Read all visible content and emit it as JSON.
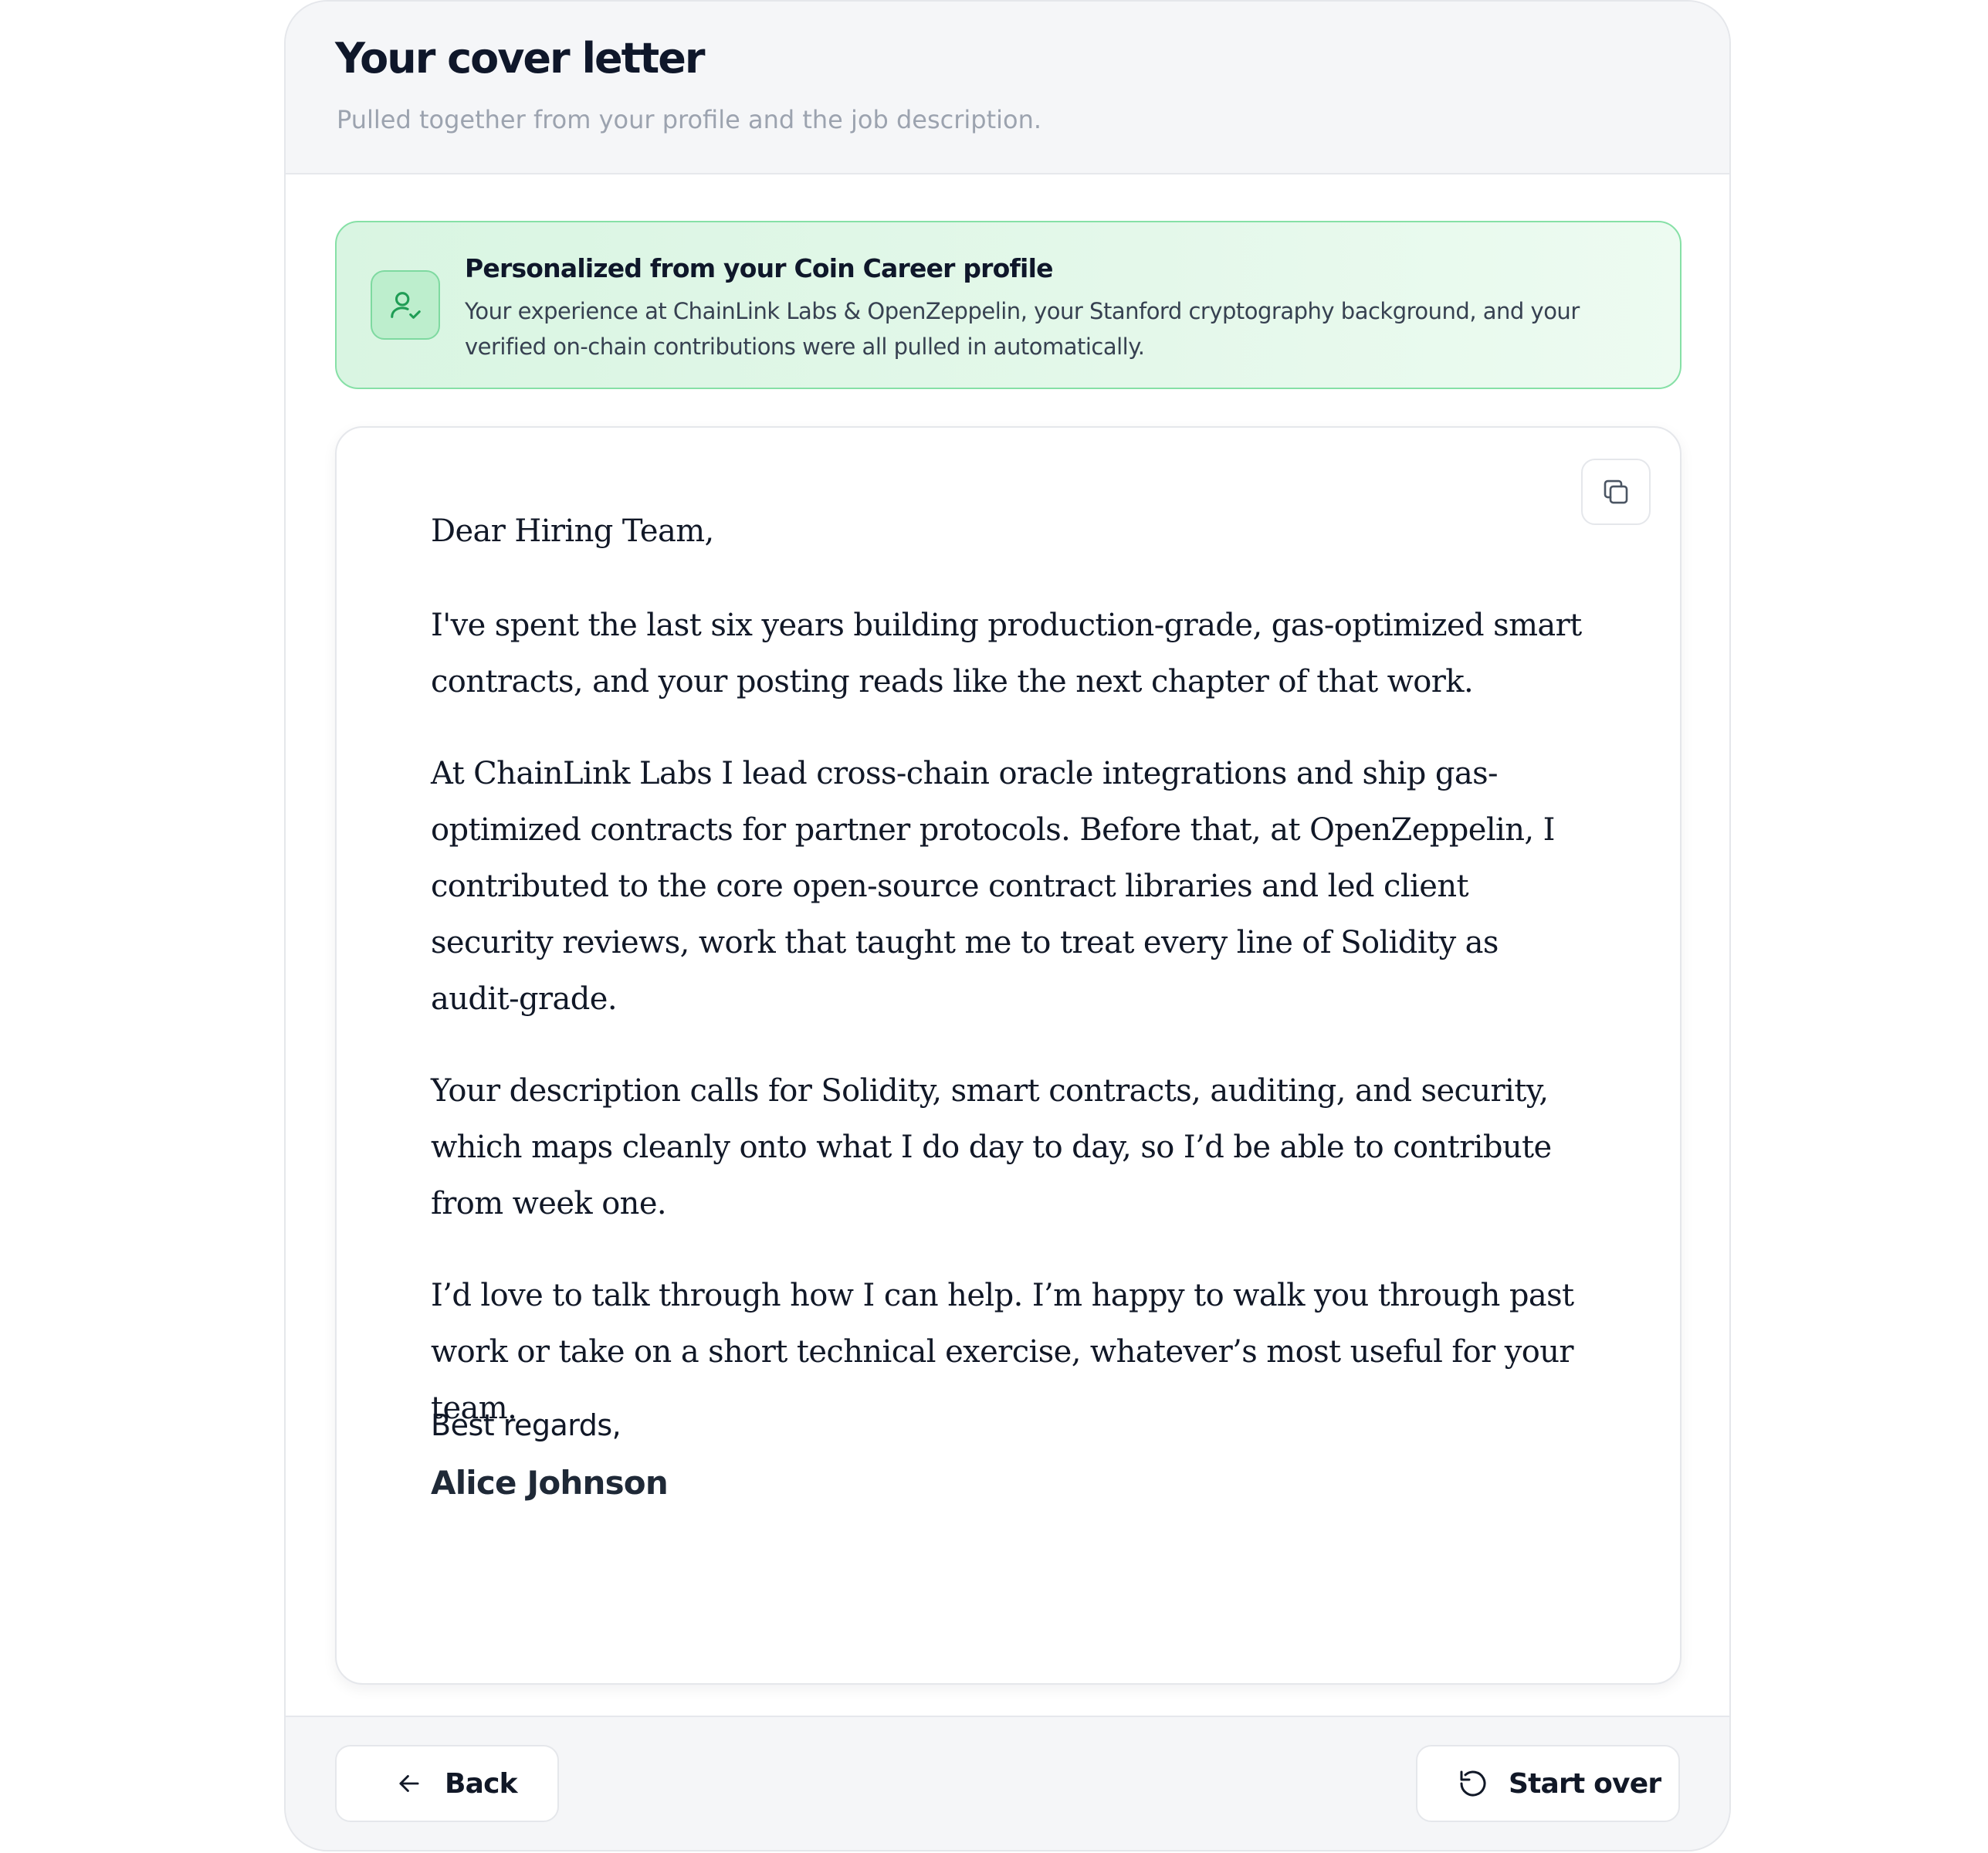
{
  "header": {
    "title": "Your cover letter",
    "subtitle": "Pulled together from your profile and the job description."
  },
  "banner": {
    "icon": "user-check-icon",
    "title": "Personalized from your Coin Career profile",
    "text": "Your experience at ChainLink Labs & OpenZeppelin, your Stanford cryptography background, and your verified on-chain contributions were all pulled in automatically."
  },
  "letter": {
    "copy_icon": "copy-icon",
    "greeting": "Dear Hiring Team,",
    "paragraphs": [
      "I've spent the last six years building production-grade, gas-optimized smart contracts, and your posting reads like the next chapter of that work.",
      "At ChainLink Labs I lead cross-chain oracle integrations and ship gas-optimized contracts for partner protocols. Before that, at OpenZeppelin, I contributed to the core open-source contract libraries and led client security reviews, work that taught me to treat every line of Solidity as audit-grade.",
      "Your description calls for Solidity, smart contracts, auditing, and security, which maps cleanly onto what I do day to day, so I’d be able to contribute from week one.",
      "I’d love to talk through how I can help. I’m happy to walk you through past work or take on a short technical exercise, whatever’s most useful for your team."
    ],
    "closing": "Best regards,",
    "signature": "Alice Johnson"
  },
  "footer": {
    "back_label": "Back",
    "back_icon": "arrow-left-icon",
    "start_over_label": "Start over",
    "start_over_icon": "rotate-ccw-icon"
  },
  "colors": {
    "accent_green": "#86e0a6",
    "icon_green": "#1f9d55",
    "text_primary": "#111827",
    "text_muted": "#9ca3af"
  }
}
